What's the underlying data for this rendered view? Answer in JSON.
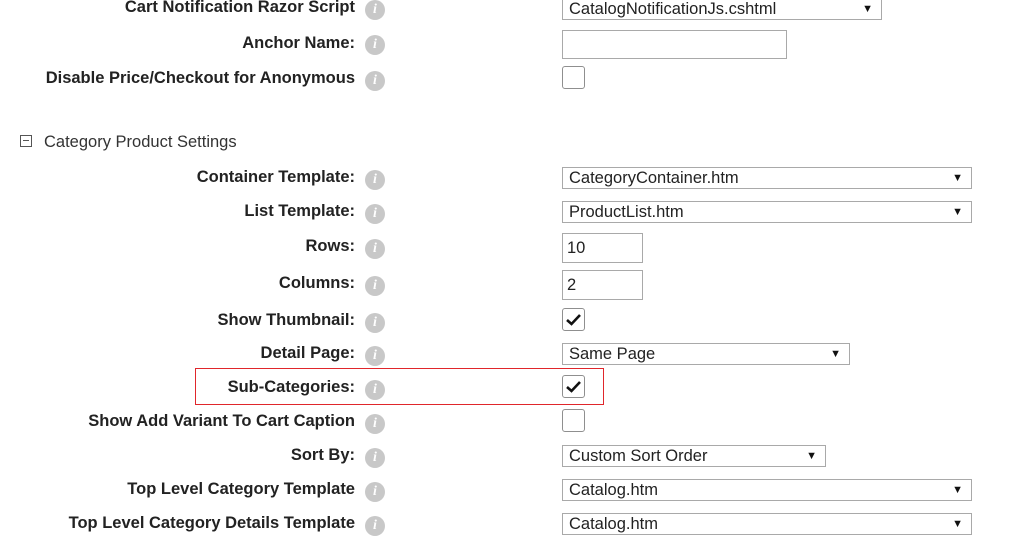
{
  "top_rows": {
    "cart_script": {
      "label": "Cart Notification Razor Script",
      "value": "CatalogNotificationJs.cshtml"
    },
    "anchor_name": {
      "label": "Anchor Name:",
      "value": ""
    },
    "disable_price": {
      "label": "Disable Price/Checkout for Anonymous",
      "checked": false
    }
  },
  "section": {
    "title": "Category Product Settings",
    "collapse_symbol": "minus-square"
  },
  "rows": {
    "container_template": {
      "label": "Container Template:",
      "value": "CategoryContainer.htm"
    },
    "list_template": {
      "label": "List Template:",
      "value": "ProductList.htm"
    },
    "rows_count": {
      "label": "Rows:",
      "value": "10"
    },
    "columns": {
      "label": "Columns:",
      "value": "2"
    },
    "show_thumbnail": {
      "label": "Show Thumbnail:",
      "checked": true
    },
    "detail_page": {
      "label": "Detail Page:",
      "value": "Same Page"
    },
    "sub_categories": {
      "label": "Sub-Categories:",
      "checked": true,
      "highlighted": true
    },
    "show_add_variant": {
      "label": "Show Add Variant To Cart Caption",
      "checked": false
    },
    "sort_by": {
      "label": "Sort By:",
      "value": "Custom Sort Order"
    },
    "top_level_template": {
      "label": "Top Level Category Template",
      "value": "Catalog.htm"
    },
    "top_level_details_template": {
      "label": "Top Level Category Details Template",
      "value": "Catalog.htm"
    }
  },
  "icons": {
    "info": "info-icon",
    "dropdown": "dropdown-arrow-icon",
    "check": "checkmark-icon"
  },
  "info_glyph": "i",
  "arrow_glyph": "▼",
  "colors": {
    "highlight": "#e0262b",
    "info_icon": "#c8c8c8"
  }
}
